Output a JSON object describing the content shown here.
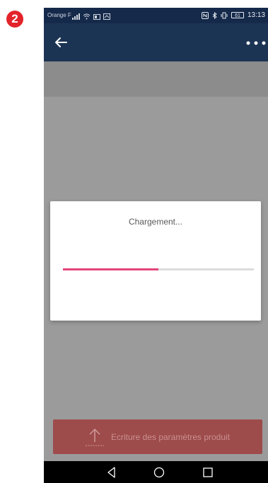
{
  "step_badge": "2",
  "status_bar": {
    "carrier": "Orange F",
    "battery": "61",
    "time": "13:13"
  },
  "dialog": {
    "title": "Chargement...",
    "progress_fraction": 0.5
  },
  "action_button": {
    "label": "Ecriture des paramètres produit",
    "icon": "upload-icon"
  },
  "nav_bar": {
    "back_icon": "nav-back-icon",
    "home_icon": "nav-home-icon",
    "recents_icon": "nav-recents-icon"
  },
  "colors": {
    "app_bar": "#1c3454",
    "status_bar": "#15294a",
    "progress": "#e4457a",
    "action_button": "#9e4b4b",
    "badge": "#e3232b"
  }
}
